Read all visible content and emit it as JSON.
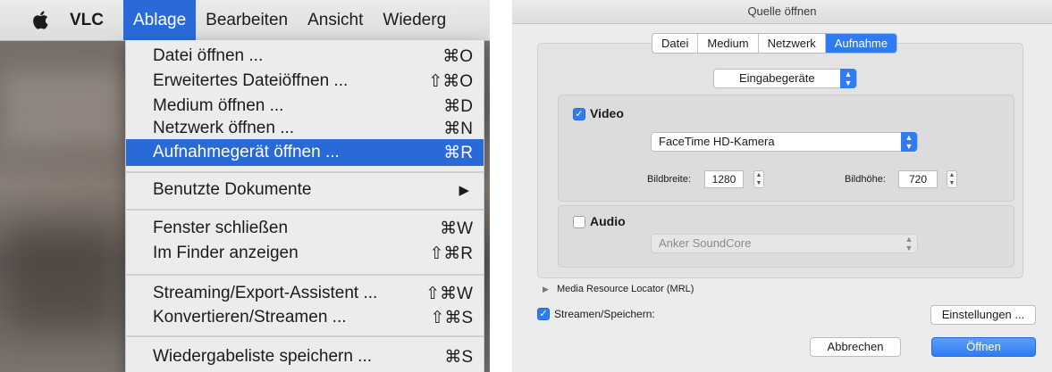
{
  "menubar": {
    "apple_icon": "apple-logo-icon",
    "items": [
      "VLC",
      "Ablage",
      "Bearbeiten",
      "Ansicht",
      "Wiederg"
    ]
  },
  "menu": {
    "items": [
      {
        "label": "Datei öffnen ...",
        "shortcut": "⌘O"
      },
      {
        "label": "Erweitertes Dateiöffnen ...",
        "shortcut": "⇧⌘O"
      },
      {
        "label": "Medium öffnen ...",
        "shortcut": "⌘D"
      },
      {
        "label": "Netzwerk öffnen ...",
        "shortcut": "⌘N"
      },
      {
        "label": "Aufnahmegerät öffnen ...",
        "shortcut": "⌘R"
      },
      {
        "label": "Benutzte Dokumente",
        "shortcut": "▶"
      },
      {
        "label": "Fenster schließen",
        "shortcut": "⌘W"
      },
      {
        "label": "Im Finder anzeigen",
        "shortcut": "⇧⌘R"
      },
      {
        "label": "Streaming/Export-Assistent ...",
        "shortcut": "⇧⌘W"
      },
      {
        "label": "Konvertieren/Streamen ...",
        "shortcut": "⇧⌘S"
      },
      {
        "label": "Wiedergabeliste speichern ...",
        "shortcut": "⌘S"
      }
    ],
    "highlighted": "Aufnahmegerät öffnen ..."
  },
  "dialog": {
    "title": "Quelle öffnen",
    "tabs": [
      "Datei",
      "Medium",
      "Netzwerk",
      "Aufnahme"
    ],
    "active_tab": "Aufnahme",
    "source_select": "Eingabegeräte",
    "video": {
      "label": "Video",
      "checked": true,
      "device": "FaceTime HD-Kamera",
      "width_label": "Bildbreite:",
      "width_value": "1280",
      "height_label": "Bildhöhe:",
      "height_value": "720"
    },
    "audio": {
      "label": "Audio",
      "checked": false,
      "device": "Anker SoundCore"
    },
    "mrl_label": "Media Resource Locator (MRL)",
    "stream_label": "Streamen/Speichern:",
    "stream_checked": true,
    "settings_button": "Einstellungen ...",
    "cancel_button": "Abbrechen",
    "open_button": "Öffnen",
    "accent_color": "#2f7bf3"
  }
}
